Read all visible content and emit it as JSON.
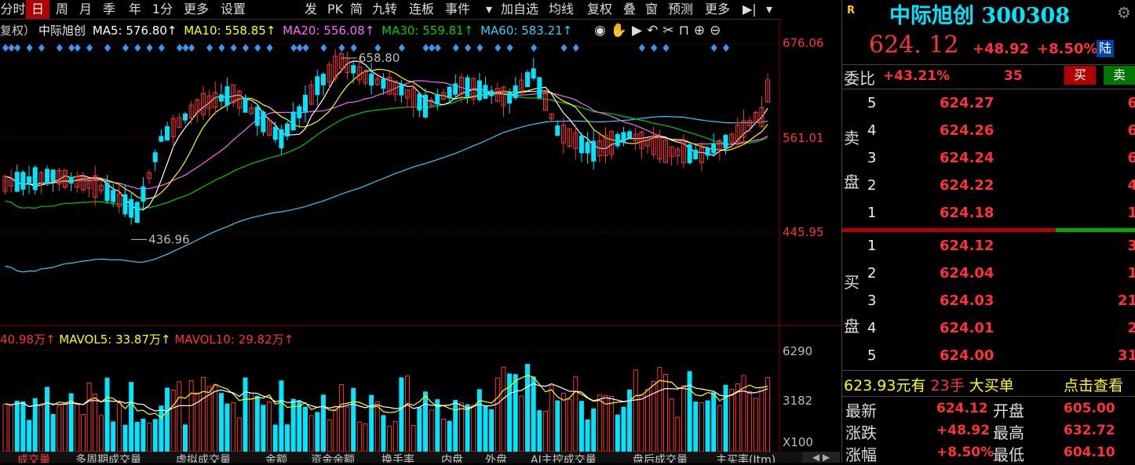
{
  "toolbar": {
    "left": [
      {
        "label": "分时",
        "selected": false
      },
      {
        "label": "日",
        "selected": true
      },
      {
        "label": "周",
        "selected": false
      },
      {
        "label": "月",
        "selected": false
      },
      {
        "label": "季",
        "selected": false
      },
      {
        "label": "年",
        "selected": false
      },
      {
        "label": "1分",
        "selected": false
      },
      {
        "label": "更多",
        "selected": false
      },
      {
        "label": "设置",
        "selected": false
      }
    ],
    "right": [
      "发",
      "PK",
      "简",
      "九转",
      "连板",
      "事件",
      "加自选",
      "均线",
      "复权",
      "叠",
      "窗",
      "预测",
      "更多"
    ]
  },
  "ma_line": {
    "prefix": "复权）",
    "name": "中际旭创",
    "ma5": "MA5: 576.80↑",
    "ma10": "MA10: 558.85↑",
    "ma20": "MA20: 556.08↑",
    "ma30": "MA30: 559.81↑",
    "ma60": "MA60: 583.21↑"
  },
  "chart_data": {
    "type": "candlestick",
    "price_axis": {
      "ticks": [
        "676.06",
        "561.01",
        "445.95"
      ]
    },
    "annotations": {
      "high": "658.80",
      "low": "436.96"
    },
    "volume_axis": {
      "ticks": [
        "6290",
        "3182",
        "X100"
      ]
    },
    "moving_averages": [
      "MA5",
      "MA10",
      "MA20",
      "MA30",
      "MA60"
    ],
    "colors": {
      "up": "#ff3333",
      "down": "#00e5ff",
      "ma5": "#ffffff",
      "ma10": "#ffff00",
      "ma20": "#ff66ff",
      "ma30": "#00cc00",
      "ma60": "#33ccff"
    }
  },
  "vol_line": {
    "vol": "40.98万↑",
    "mavol5": "MAVOL5: 33.87万↑",
    "mavol10": "MAVOL10: 29.82万↑"
  },
  "bottom_tabs": [
    "成交量",
    "多周期成交量",
    "虚拟成交量",
    "金额",
    "资金余额",
    "换手率",
    "内盘",
    "外盘",
    "AI主控成交量",
    "盘后成交量",
    "主买率(Itm)"
  ],
  "quote": {
    "badge": "R",
    "name": "中际旭创",
    "code": "300308",
    "price": "624. 12",
    "change": "+48.92",
    "pct": "+8.50%",
    "market": "陆",
    "weibi_label": "委比",
    "weibi_value": "+43.21%",
    "weicha": "35",
    "buy_btn": "买",
    "sell_btn": "卖",
    "sell_label_1": "卖",
    "sell_label_2": "盘",
    "buy_label_1": "买",
    "buy_label_2": "盘",
    "asks": [
      {
        "level": "5",
        "price": "624.27",
        "vol": "6"
      },
      {
        "level": "4",
        "price": "624.26",
        "vol": "6"
      },
      {
        "level": "3",
        "price": "624.24",
        "vol": "6"
      },
      {
        "level": "2",
        "price": "624.22",
        "vol": "4"
      },
      {
        "level": "1",
        "price": "624.18",
        "vol": "1"
      }
    ],
    "bids": [
      {
        "level": "1",
        "price": "624.12",
        "vol": "3"
      },
      {
        "level": "2",
        "price": "624.04",
        "vol": "1"
      },
      {
        "level": "3",
        "price": "624.03",
        "vol": "21"
      },
      {
        "level": "4",
        "price": "624.01",
        "vol": "2"
      },
      {
        "level": "5",
        "price": "624.00",
        "vol": "31"
      }
    ],
    "big_order": {
      "price": "623.93元有",
      "qty": "23手",
      "text": "大买单",
      "link": "点击查看"
    },
    "stats": [
      {
        "l1": "最新",
        "v1": "624.12",
        "l2": "开盘",
        "v2": "605.00"
      },
      {
        "l1": "涨跌",
        "v1": "+48.92",
        "l2": "最高",
        "v2": "632.72"
      },
      {
        "l1": "涨幅",
        "v1": "+8.50%",
        "l2": "最低",
        "v2": "604.10"
      }
    ]
  }
}
